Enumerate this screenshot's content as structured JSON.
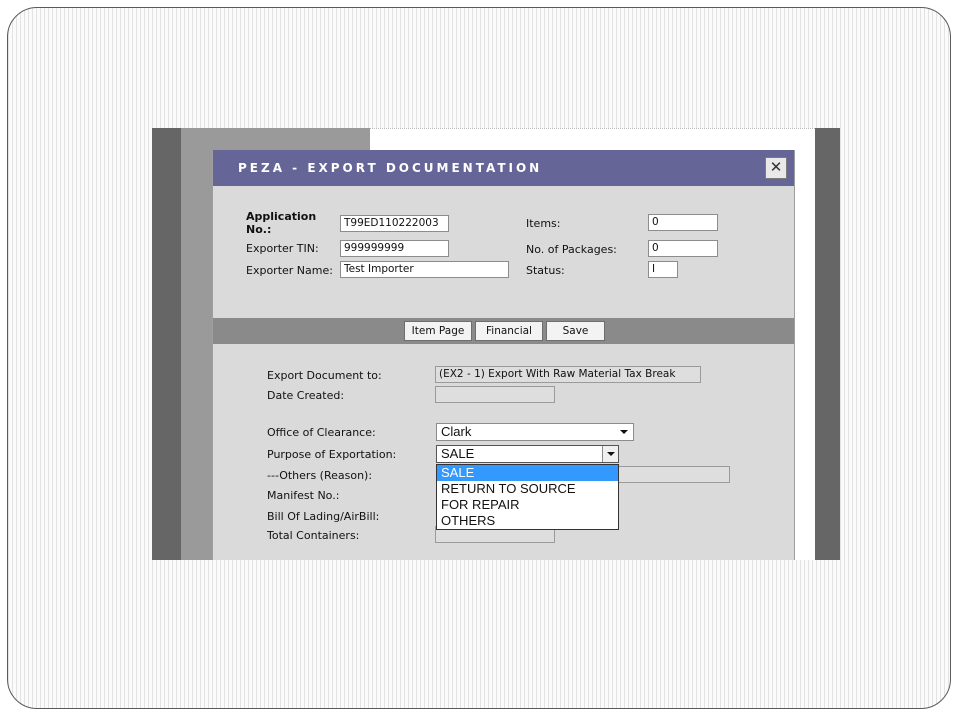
{
  "dialog": {
    "title": "PEZA - EXPORT DOCUMENTATION",
    "close_symbol": "✕"
  },
  "header": {
    "application_no_label": "Application No.:",
    "application_no_value": "T99ED110222003",
    "exporter_tin_label": "Exporter TIN:",
    "exporter_tin_value": "999999999",
    "exporter_name_label": "Exporter Name:",
    "exporter_name_value": "Test Importer",
    "items_label": "Items:",
    "items_value": "0",
    "packages_label": "No. of Packages:",
    "packages_value": "0",
    "status_label": "Status:",
    "status_value": "I"
  },
  "toolbar": {
    "item_page_label": "Item Page",
    "financial_label": "Financial",
    "save_label": "Save"
  },
  "form": {
    "export_doc_label": "Export Document to:",
    "export_doc_value": "(EX2 - 1) Export With Raw Material Tax Break",
    "date_created_label": "Date Created:",
    "date_created_value": "",
    "office_label": "Office of Clearance:",
    "office_value": "Clark",
    "purpose_label": "Purpose of Exportation:",
    "purpose_value": "SALE",
    "others_label": "---Others (Reason):",
    "manifest_label": "Manifest No.:",
    "bill_label": "Bill Of Lading/AirBill:",
    "containers_label": "Total Containers:"
  },
  "purpose_options": [
    "SALE",
    "RETURN TO SOURCE",
    "FOR REPAIR",
    "OTHERS"
  ],
  "colors": {
    "title_bar": "#656598",
    "selection": "#3399ff"
  }
}
